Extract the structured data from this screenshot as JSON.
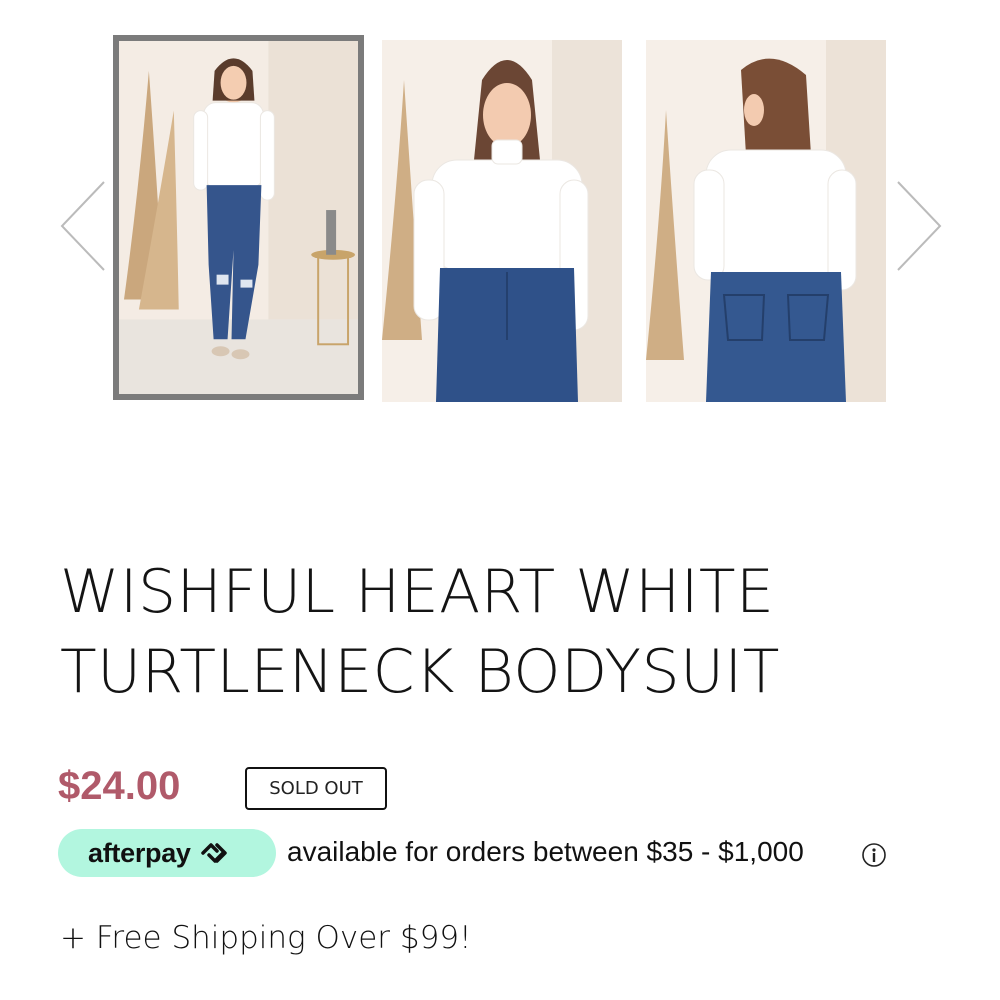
{
  "carousel": {
    "prev_icon": "chevron-left-icon",
    "next_icon": "chevron-right-icon",
    "thumbnails": [
      "full-body-front-view",
      "front-close-up-view",
      "back-view"
    ],
    "selected_index": 0
  },
  "product": {
    "title_line1": "WISHFUL HEART WHITE",
    "title_line2": "TURTLENECK BODYSUIT",
    "price": "$24.00",
    "status_badge": "SOLD OUT"
  },
  "afterpay": {
    "brand": "afterpay",
    "message": "available for orders between $35 - $1,000",
    "info_icon": "info-icon"
  },
  "shipping": {
    "text": "+ Free Shipping Over $99!"
  },
  "colors": {
    "price": "#b05a6a",
    "afterpay_mint": "#b2f6df",
    "thumb_border": "#7b7b7b"
  }
}
